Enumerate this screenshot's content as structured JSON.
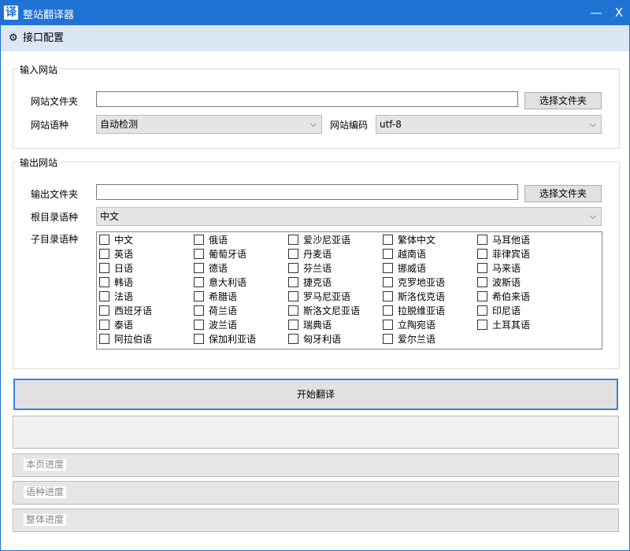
{
  "window": {
    "title": "整站翻译器",
    "icon_char": "译",
    "minimize": "—",
    "close": "X"
  },
  "menu": {
    "config_label": "接口配置"
  },
  "input_group": {
    "title": "输入网站",
    "folder_label": "网站文件夹",
    "folder_value": "",
    "browse_label": "选择文件夹",
    "language_label": "网站语种",
    "language_value": "自动检测",
    "encoding_label": "网站编码",
    "encoding_value": "utf-8"
  },
  "output_group": {
    "title": "输出网站",
    "folder_label": "输出文件夹",
    "folder_value": "",
    "browse_label": "选择文件夹",
    "root_lang_label": "根目录语种",
    "root_lang_value": "中文",
    "sub_lang_label": "子目录语种",
    "languages": [
      [
        "中文",
        "英语",
        "日语",
        "韩语",
        "法语",
        "西班牙语",
        "泰语",
        "阿拉伯语"
      ],
      [
        "俄语",
        "葡萄牙语",
        "德语",
        "意大利语",
        "希腊语",
        "荷兰语",
        "波兰语",
        "保加利亚语"
      ],
      [
        "爱沙尼亚语",
        "丹麦语",
        "芬兰语",
        "捷克语",
        "罗马尼亚语",
        "斯洛文尼亚语",
        "瑞典语",
        "匈牙利语"
      ],
      [
        "繁体中文",
        "越南语",
        "挪威语",
        "克罗地亚语",
        "斯洛伐克语",
        "拉脱维亚语",
        "立陶宛语",
        "爱尔兰语"
      ],
      [
        "马耳他语",
        "菲律宾语",
        "马来语",
        "波斯语",
        "希伯来语",
        "印尼语",
        "土耳其语"
      ]
    ]
  },
  "start_label": "开始翻译",
  "progress": {
    "page_label": "本页进度",
    "page_value": 0,
    "lang_label": "语种进度",
    "lang_value": 0,
    "total_label": "整体进度",
    "total_value": 0
  }
}
